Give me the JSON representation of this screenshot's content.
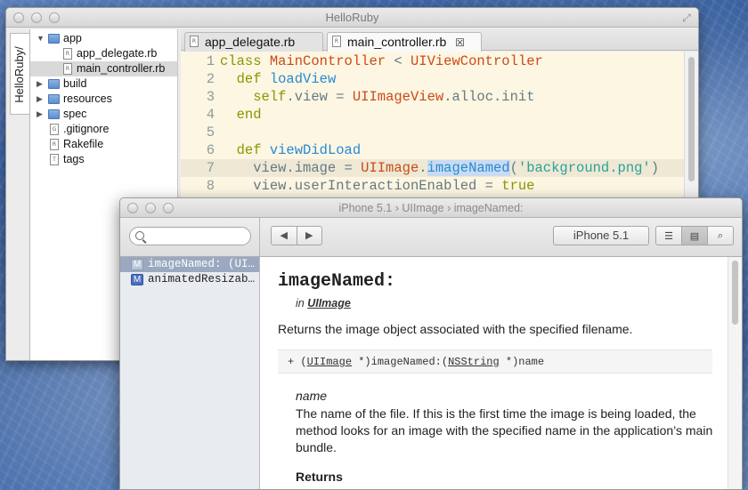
{
  "main_window": {
    "title": "HelloRuby",
    "sidebar_tab": "HelloRuby/",
    "tree": [
      {
        "label": "app",
        "type": "folder",
        "disclosure": "▼",
        "depth": 0
      },
      {
        "label": "app_delegate.rb",
        "type": "file",
        "file_badge": "R",
        "depth": 1
      },
      {
        "label": "main_controller.rb",
        "type": "file",
        "file_badge": "R",
        "depth": 1,
        "selected": true
      },
      {
        "label": "build",
        "type": "folder",
        "disclosure": "▶",
        "depth": 0
      },
      {
        "label": "resources",
        "type": "folder",
        "disclosure": "▶",
        "depth": 0
      },
      {
        "label": "spec",
        "type": "folder",
        "disclosure": "▶",
        "depth": 0
      },
      {
        "label": ".gitignore",
        "type": "file",
        "file_badge": "G",
        "depth": 0
      },
      {
        "label": "Rakefile",
        "type": "file",
        "file_badge": "R",
        "depth": 0
      },
      {
        "label": "tags",
        "type": "file",
        "file_badge": "T",
        "depth": 0
      }
    ],
    "tabs": [
      {
        "label": "app_delegate.rb",
        "active": false
      },
      {
        "label": "main_controller.rb",
        "active": true,
        "close_glyph": "☒"
      }
    ],
    "fullscreen_glyph": "⤢"
  },
  "code": {
    "lines": [
      {
        "no": "1",
        "current": false
      },
      {
        "no": "2",
        "current": false
      },
      {
        "no": "3",
        "current": false
      },
      {
        "no": "4",
        "current": false
      },
      {
        "no": "5",
        "current": false
      },
      {
        "no": "6",
        "current": false
      },
      {
        "no": "7",
        "current": true
      },
      {
        "no": "8",
        "current": false
      }
    ],
    "tokens": {
      "l1": [
        "class",
        "MainController",
        " < ",
        "UIViewController"
      ],
      "l2": [
        "def",
        "loadView"
      ],
      "l3": [
        "self",
        ".view = ",
        "UIImageView",
        ".alloc.init"
      ],
      "l4": [
        "end"
      ],
      "l6": [
        "def",
        "viewDidLoad"
      ],
      "l7": [
        "view.image = ",
        "UIImage",
        ".",
        "imageNamed",
        "(",
        "'background.png'",
        ")"
      ],
      "l8": [
        "view.userInteractionEnabled = ",
        "true"
      ]
    }
  },
  "doc_window": {
    "title": "iPhone 5.1 › UIImage › imageNamed:",
    "search_placeholder": "",
    "nav_back": "◀",
    "nav_forward": "▶",
    "sdk_label": "iPhone 5.1",
    "view_buttons": [
      "☰",
      "▤",
      "⌕"
    ],
    "methods": [
      {
        "badge": "M",
        "label": "imageNamed: (UI…",
        "selected": true
      },
      {
        "badge": "M",
        "label": "animatedResizab…",
        "selected": false
      }
    ],
    "content": {
      "title": "imageNamed:",
      "in_prefix": "in ",
      "in_class": "UIImage",
      "summary": "Returns the image object associated with the specified filename.",
      "decl_prefix": "+ (",
      "decl_type": "UIImage",
      "decl_mid": " *)imageNamed:(",
      "decl_arg_type": "NSString",
      "decl_suffix": " *)name",
      "param_name": "name",
      "param_desc": "The name of the file. If this is the first time the image is being loaded, the method looks for an image with the specified name in the application’s main bundle.",
      "returns_heading": "Returns"
    }
  },
  "colors": {
    "editor_bg": "#fdf6e3",
    "keyword": "#859900",
    "class_name": "#cb4b16",
    "method_name": "#268bd2",
    "string": "#2aa198",
    "selection": "#9aa9c0"
  }
}
